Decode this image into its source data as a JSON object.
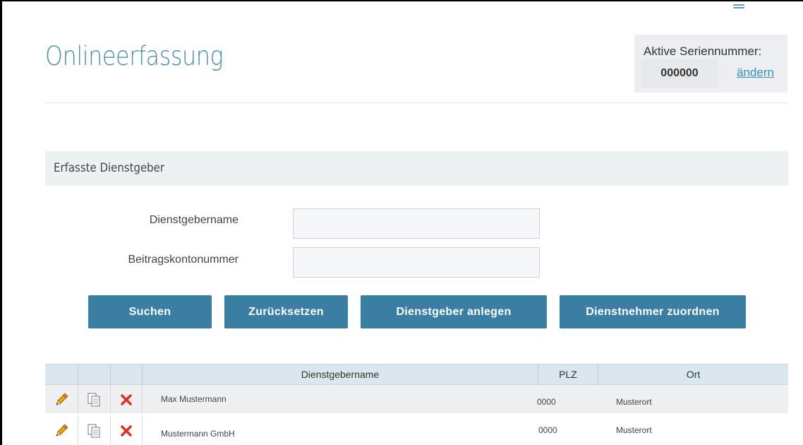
{
  "header": {
    "title": "Onlineerfassung",
    "serial": {
      "label": "Aktive Seriennummer:",
      "value": "000000",
      "change_link": "ändern"
    }
  },
  "section": {
    "title": "Erfasste Dienstgeber"
  },
  "form": {
    "employer_name_label": "Dienstgebername",
    "employer_name_value": "",
    "account_number_label": "Beitragskontonummer",
    "account_number_value": ""
  },
  "buttons": {
    "search": "Suchen",
    "reset": "Zurücksetzen",
    "create_employer": "Dienstgeber anlegen",
    "assign_employees": "Dienstnehmer zuordnen"
  },
  "table": {
    "columns": [
      "",
      "",
      "",
      "Dienstgebername",
      "PLZ",
      "Ort"
    ],
    "rows": [
      {
        "name": "Max Mustermann",
        "plz": "0000",
        "ort": "Musterort"
      },
      {
        "name": "Mustermann GmbH",
        "plz": "0000",
        "ort": "Musterort"
      }
    ],
    "row_icons": [
      "pencil-icon",
      "copy-icon",
      "delete-icon"
    ]
  },
  "colors": {
    "accent": "#3a7fa3",
    "title": "#4a90a8",
    "link": "#3a8fb7",
    "delete": "#e0302a",
    "pencil": "#e8a317"
  }
}
